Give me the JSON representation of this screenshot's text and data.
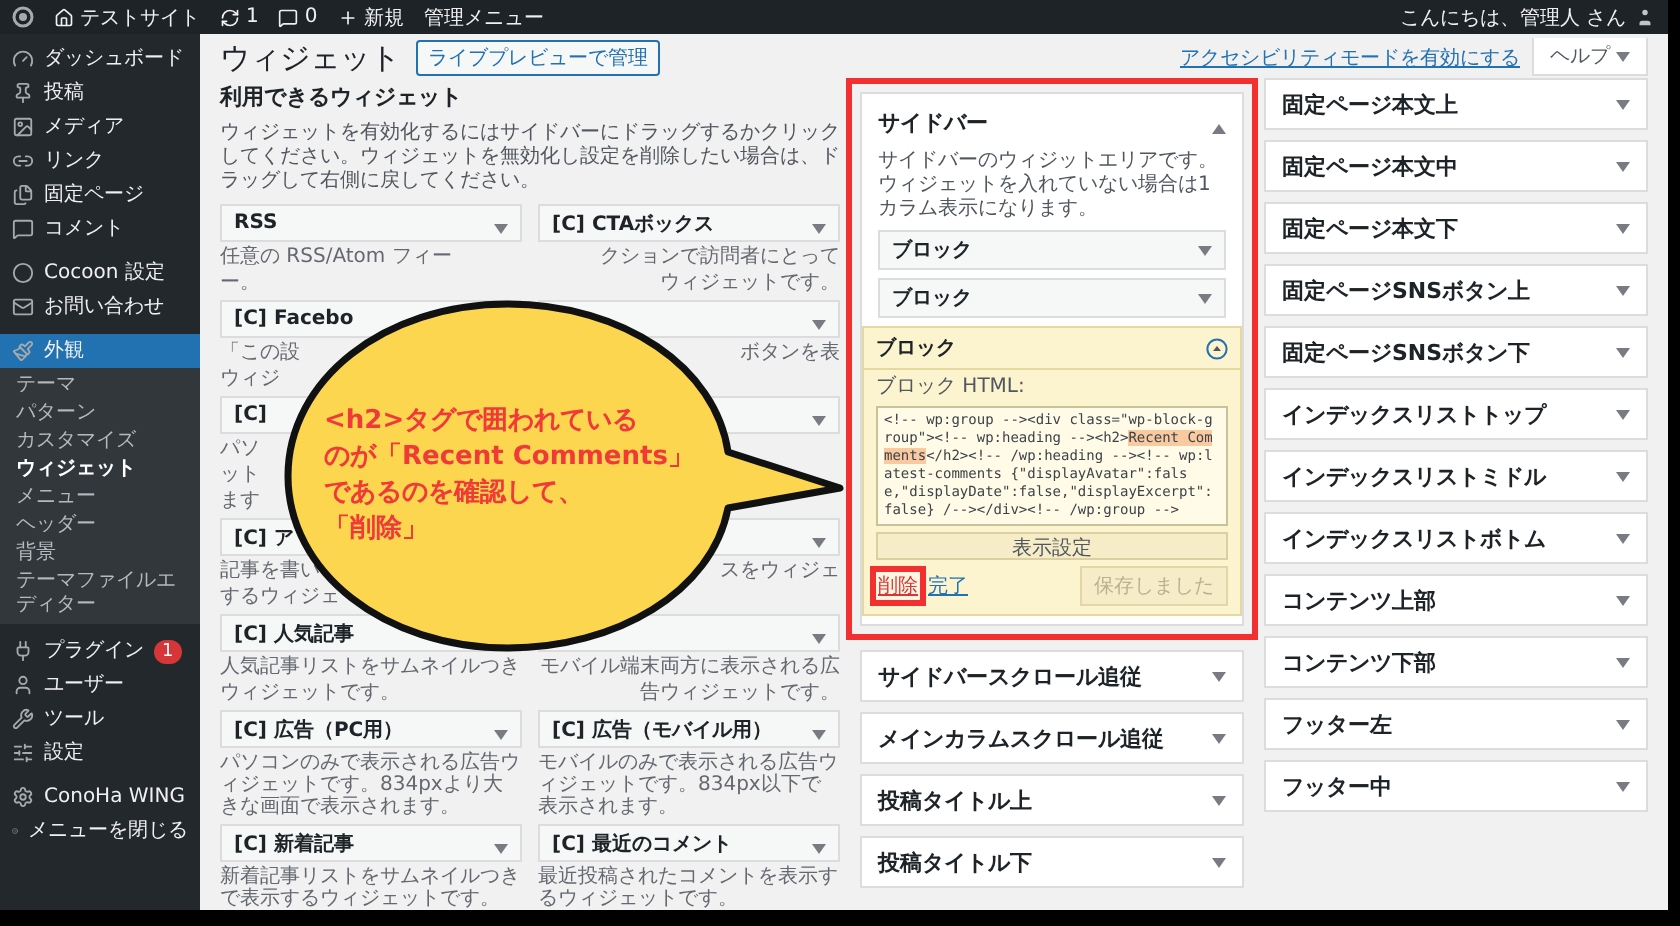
{
  "admin_bar": {
    "site": "テストサイト",
    "updates": "1",
    "comments": "0",
    "new": "新規",
    "menu": "管理メニュー",
    "greeting": "こんにちは、管理人 さん"
  },
  "admin_menu": [
    {
      "label": "ダッシュボード",
      "selected": false
    },
    {
      "label": "投稿",
      "selected": false
    },
    {
      "label": "メディア",
      "selected": false
    },
    {
      "label": "リンク",
      "selected": false
    },
    {
      "label": "固定ページ",
      "selected": false
    },
    {
      "label": "コメント",
      "selected": false
    },
    {
      "label": "Cocoon 設定",
      "selected": false
    },
    {
      "label": "お問い合わせ",
      "selected": false
    },
    {
      "label": "外観",
      "selected": true,
      "children": [
        {
          "label": "テーマ",
          "selected": false
        },
        {
          "label": "パターン",
          "selected": false
        },
        {
          "label": "カスタマイズ",
          "selected": false
        },
        {
          "label": "ウィジェット",
          "selected": true
        },
        {
          "label": "メニュー",
          "selected": false
        },
        {
          "label": "ヘッダー",
          "selected": false
        },
        {
          "label": "背景",
          "selected": false
        },
        {
          "label": "テーマファイルエディター",
          "selected": false
        }
      ]
    },
    {
      "label": "プラグイン",
      "selected": false,
      "badge": "1"
    },
    {
      "label": "ユーザー",
      "selected": false
    },
    {
      "label": "ツール",
      "selected": false
    },
    {
      "label": "設定",
      "selected": false
    },
    {
      "label": "ConoHa WING",
      "selected": false
    },
    {
      "label": "メニューを閉じる",
      "selected": false
    }
  ],
  "screen_links": {
    "accessibility": "アクセシビリティモードを有効にする",
    "help": "ヘルプ"
  },
  "page": {
    "title": "ウィジェット",
    "action": "ライブプレビューで管理"
  },
  "available": {
    "title": "利用できるウィジェット",
    "description": "ウィジェットを有効化するにはサイドバーにドラッグするかクリックしてください。ウィジェットを無効化し設定を削除したい場合は、ドラッグして右側に戻してください。",
    "widgets": [
      {
        "title": "RSS",
        "expanded": false,
        "description": [
          "任意の RSS/Atom フィー",
          "ー。"
        ],
        "end_visible": false
      },
      {
        "title": "[C] CTAボックス",
        "expanded": false,
        "description": [
          "クションで訪問者にとって",
          "ウィジェットです。"
        ],
        "end_visible": true
      },
      {
        "title": "[C] Facebo",
        "description": [
          "「この設",
          "ウィジ"
        ],
        "end_visible": false
      },
      {
        "expanded": false,
        "description": [
          "ボタンを表"
        ],
        "end_visible": true
      },
      {
        "title": "[C]",
        "description": [
          "パソ",
          "ット",
          "ます"
        ],
        "end_visible": false
      },
      {
        "expanded": false
      },
      {
        "title": "[C] ア",
        "description": [
          "記事を書い",
          "するウィジェ"
        ],
        "end_visible": false
      },
      {
        "expanded": false,
        "description": [
          "スをウィジェ"
        ],
        "end_visible": true
      },
      {
        "title": "[C] 人気記事",
        "description": [
          "人気記事リストをサムネイルつき",
          "ウィジェットです。"
        ],
        "end_visible": false
      },
      {
        "expanded": false,
        "description": [
          "モバイル端末両方に表示される広",
          "告ウィジェットです。"
        ],
        "end_visible": true
      },
      {
        "title": "[C] 広告（PC用）",
        "expanded": false,
        "description": [
          "パソコンのみで表示される広告ウィジェットです。834pxより大きな画面で表示されます。"
        ]
      },
      {
        "title": "[C] 広告（モバイル用）",
        "expanded": false,
        "description": [
          "モバイルのみで表示される広告ウィジェットです。834px以下で表示されます。"
        ]
      },
      {
        "title": "[C] 新着記事",
        "expanded": false,
        "description": [
          "新着記事リストをサムネイルつきで表示するウィジェットです。"
        ]
      },
      {
        "title": "[C] 最近のコメント",
        "expanded": false,
        "description": [
          "最近投稿されたコメントを表示するウィジェットです。"
        ]
      }
    ]
  },
  "sidebar_area": {
    "title": "サイドバー",
    "expanded": true,
    "highlighted": true,
    "description": "サイドバーのウィジットエリアです。ウィジェットを入れていない場合は1カラム表示になります。",
    "widgets": [
      {
        "title": "ブロック",
        "expanded": false
      },
      {
        "title": "ブロック",
        "expanded": false
      },
      {
        "title": "ブロック",
        "expanded": true,
        "field_label": "ブロック HTML:",
        "code": [
          {
            "text": "<!-- wp:group --><div class=\"wp-block-group\"><!-- wp:heading --><h2>",
            "highlighted": false
          },
          {
            "text": "Recent Comments",
            "highlighted": true
          },
          {
            "text": "</h2><!-- /wp:heading --><!-- wp:latest-comments {\"displayAvatar\":false,\"displayDate\":false,\"displayExcerpt\":false} /--></div><!-- /wp:group -->",
            "highlighted": false
          }
        ],
        "settings_button": "表示設定",
        "delete_link": {
          "label": "削除",
          "highlighted": true
        },
        "done_link": "完了",
        "save_button": {
          "label": "保存しました",
          "disabled": true
        }
      }
    ]
  },
  "middle_areas": [
    {
      "title": "サイドバースクロール追従"
    },
    {
      "title": "メインカラムスクロール追従"
    },
    {
      "title": "投稿タイトル上"
    },
    {
      "title": "投稿タイトル下"
    }
  ],
  "right_areas": [
    {
      "title": "固定ページ本文上"
    },
    {
      "title": "固定ページ本文中"
    },
    {
      "title": "固定ページ本文下"
    },
    {
      "title": "固定ページSNSボタン上"
    },
    {
      "title": "固定ページSNSボタン下"
    },
    {
      "title": "インデックスリストトップ"
    },
    {
      "title": "インデックスリストミドル"
    },
    {
      "title": "インデックスリストボトム"
    },
    {
      "title": "コンテンツ上部"
    },
    {
      "title": "コンテンツ下部"
    },
    {
      "title": "フッター左"
    },
    {
      "title": "フッター中"
    }
  ],
  "callout": {
    "lines": [
      "<h2>タグで囲われている",
      "のが「Recent Comments」",
      "であるのを確認して、",
      "「削除」"
    ]
  }
}
